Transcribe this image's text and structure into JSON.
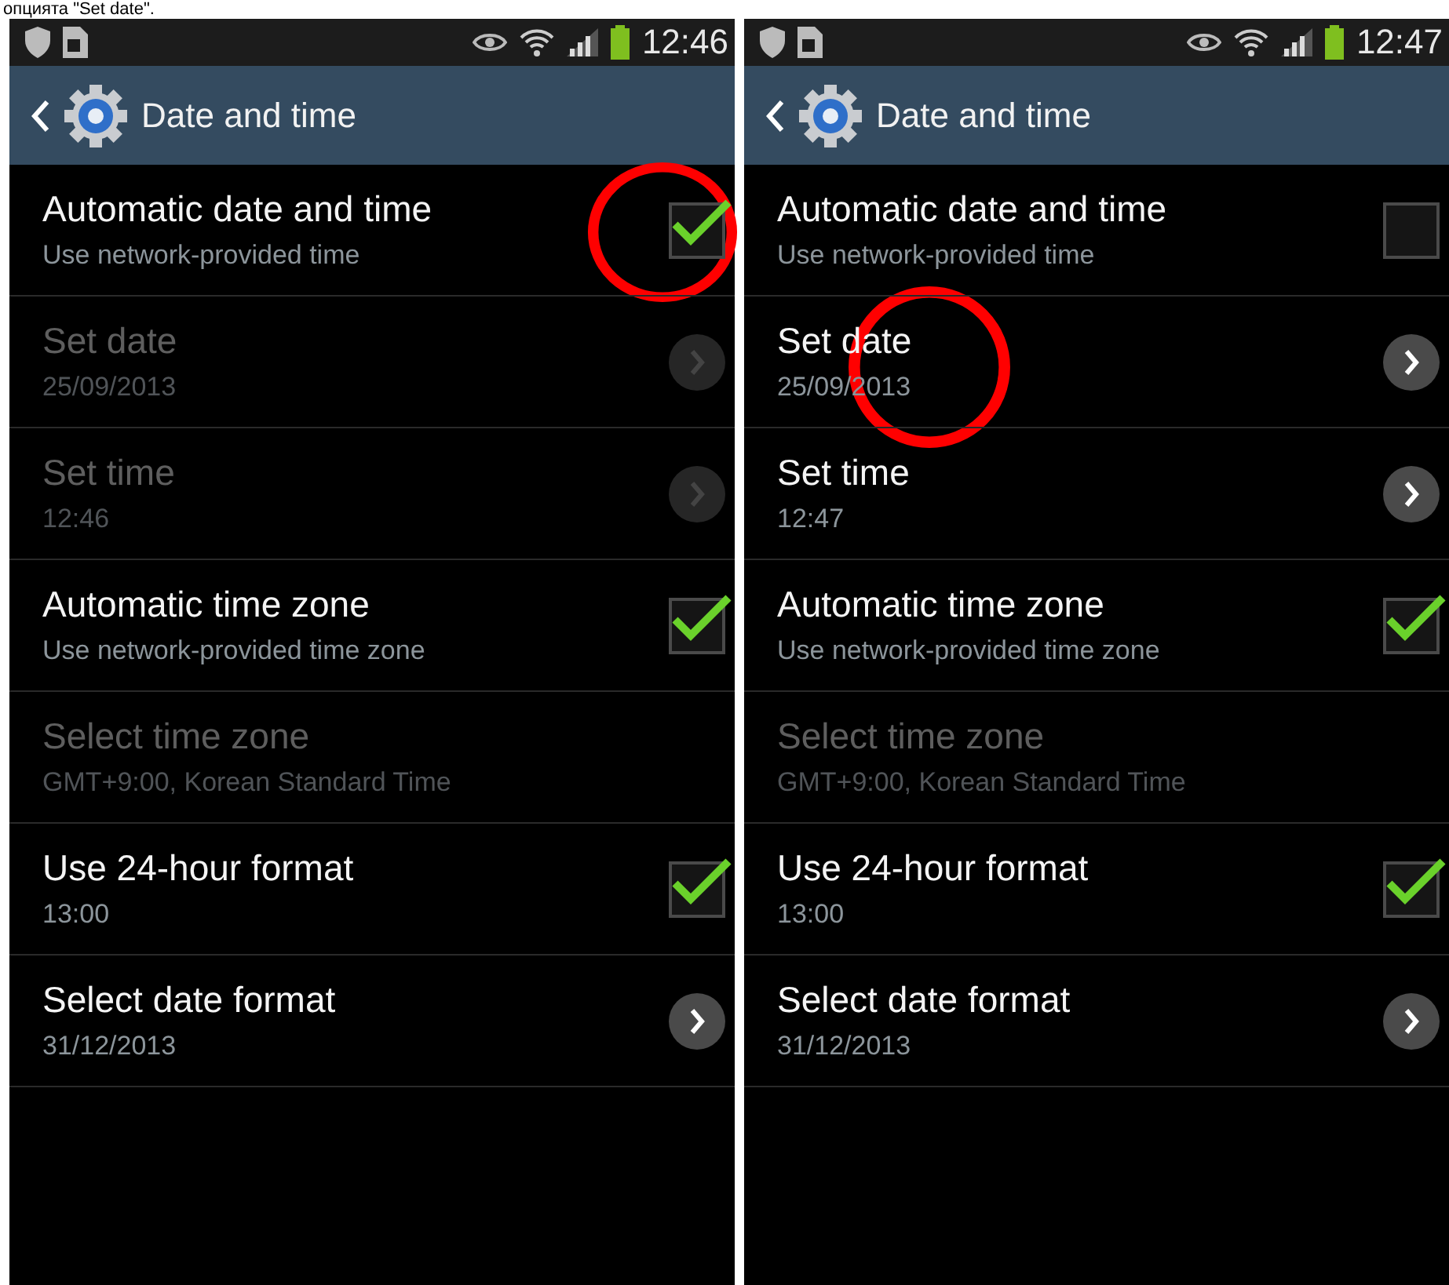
{
  "caption": "опцията \"Set date\".",
  "screens": [
    {
      "status_bar": {
        "time": "12:46"
      },
      "action_bar": {
        "title": "Date and time"
      },
      "rows": [
        {
          "title": "Automatic date and time",
          "subtitle": "Use network-provided time",
          "kind": "checkbox",
          "checked": true,
          "disabled": false,
          "circled": true
        },
        {
          "title": "Set date",
          "subtitle": "25/09/2013",
          "kind": "arrow",
          "disabled": true,
          "circled": false
        },
        {
          "title": "Set time",
          "subtitle": "12:46",
          "kind": "arrow",
          "disabled": true,
          "circled": false
        },
        {
          "title": "Automatic time zone",
          "subtitle": "Use network-provided time zone",
          "kind": "checkbox",
          "checked": true,
          "disabled": false,
          "circled": false
        },
        {
          "title": "Select time zone",
          "subtitle": "GMT+9:00, Korean Standard Time",
          "kind": "plain",
          "disabled": true,
          "circled": false
        },
        {
          "title": "Use 24-hour format",
          "subtitle": "13:00",
          "kind": "checkbox",
          "checked": true,
          "disabled": false,
          "circled": false
        },
        {
          "title": "Select date format",
          "subtitle": "31/12/2013",
          "kind": "arrow",
          "disabled": false,
          "circled": false
        }
      ]
    },
    {
      "status_bar": {
        "time": "12:47"
      },
      "action_bar": {
        "title": "Date and time"
      },
      "rows": [
        {
          "title": "Automatic date and time",
          "subtitle": "Use network-provided time",
          "kind": "checkbox",
          "checked": false,
          "disabled": false,
          "circled": false
        },
        {
          "title": "Set date",
          "subtitle": "25/09/2013",
          "kind": "arrow",
          "disabled": false,
          "circled": true
        },
        {
          "title": "Set time",
          "subtitle": "12:47",
          "kind": "arrow",
          "disabled": false,
          "circled": false
        },
        {
          "title": "Automatic time zone",
          "subtitle": "Use network-provided time zone",
          "kind": "checkbox",
          "checked": true,
          "disabled": false,
          "circled": false
        },
        {
          "title": "Select time zone",
          "subtitle": "GMT+9:00, Korean Standard Time",
          "kind": "plain",
          "disabled": true,
          "circled": false
        },
        {
          "title": "Use 24-hour format",
          "subtitle": "13:00",
          "kind": "checkbox",
          "checked": true,
          "disabled": false,
          "circled": false
        },
        {
          "title": "Select date format",
          "subtitle": "31/12/2013",
          "kind": "arrow",
          "disabled": false,
          "circled": false
        }
      ]
    }
  ]
}
